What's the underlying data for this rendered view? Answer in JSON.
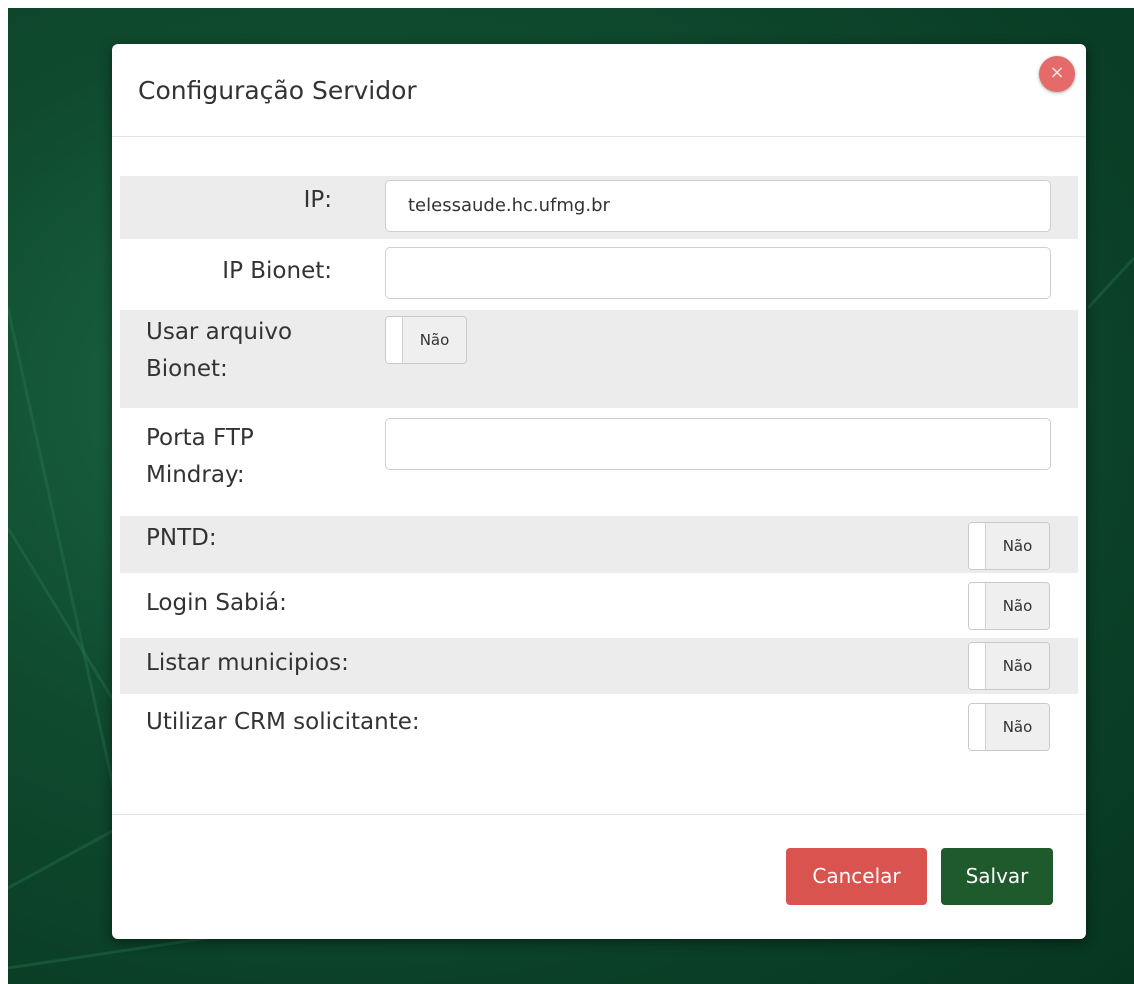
{
  "modal": {
    "title": "Configuração Servidor",
    "close_icon": "×"
  },
  "form": {
    "ip": {
      "label": "IP:",
      "value": "telessaude.hc.ufmg.br"
    },
    "ip_bionet": {
      "label": "IP Bionet:",
      "value": ""
    },
    "usar_arquivo_bionet": {
      "label_line1": "Usar arquivo",
      "label_line2": "Bionet:",
      "state": "Não"
    },
    "porta_ftp_mindray": {
      "label_line1": "Porta FTP",
      "label_line2": "Mindray:",
      "value": ""
    },
    "pntd": {
      "label": "PNTD:",
      "state": "Não"
    },
    "login_sabia": {
      "label": "Login Sabiá:",
      "state": "Não"
    },
    "listar_municipios": {
      "label": "Listar municipios:",
      "state": "Não"
    },
    "utilizar_crm": {
      "label": "Utilizar CRM solicitante:",
      "state": "Não"
    }
  },
  "footer": {
    "cancel_label": "Cancelar",
    "save_label": "Salvar"
  },
  "colors": {
    "backdrop": "#0f4a2e",
    "cancel": "#d9534f",
    "save": "#1f5a2c",
    "close": "#e46b69",
    "row_shade": "#ececec"
  }
}
